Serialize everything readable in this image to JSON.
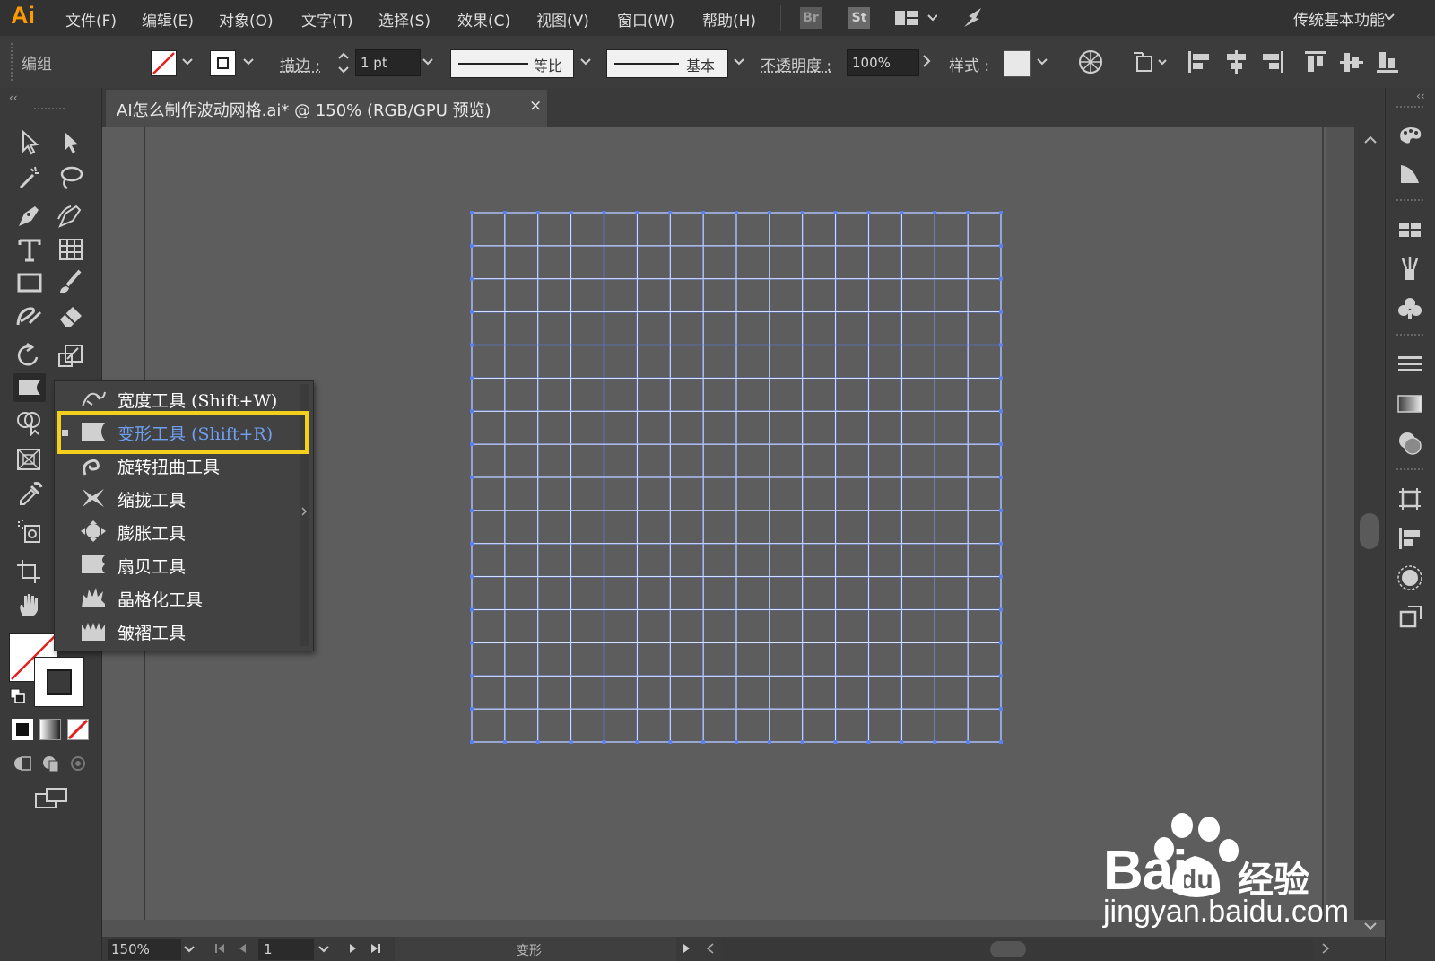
{
  "app": {
    "logo": "Ai"
  },
  "menubar": {
    "items": [
      "文件(F)",
      "编辑(E)",
      "对象(O)",
      "文字(T)",
      "选择(S)",
      "效果(C)",
      "视图(V)",
      "窗口(W)",
      "帮助(H)"
    ],
    "bridge_label": "Br",
    "stock_label": "St",
    "workspace": "传统基本功能"
  },
  "controlbar": {
    "selection_label": "编组",
    "stroke_label": "描边 :",
    "stroke_weight": "1 pt",
    "profile_label": "等比",
    "brush_label": "基本",
    "opacity_label": "不透明度 :",
    "opacity_value": "100%",
    "style_label": "样式 :"
  },
  "document": {
    "tab_title": "AI怎么制作波动网格.ai* @ 150% (RGB/GPU 预览)",
    "close_glyph": "×"
  },
  "grid": {
    "columns": 16,
    "rows": 16,
    "line_color": "#5a7ff0",
    "center_line_color": "#ffffff"
  },
  "flyout": {
    "items": [
      {
        "label": "宽度工具",
        "shortcut": "(Shift+W)",
        "icon": "width-tool-icon",
        "selected": false
      },
      {
        "label": "变形工具",
        "shortcut": "(Shift+R)",
        "icon": "warp-tool-icon",
        "selected": true
      },
      {
        "label": "旋转扭曲工具",
        "shortcut": "",
        "icon": "twirl-tool-icon",
        "selected": false
      },
      {
        "label": "缩拢工具",
        "shortcut": "",
        "icon": "pucker-tool-icon",
        "selected": false
      },
      {
        "label": "膨胀工具",
        "shortcut": "",
        "icon": "bloat-tool-icon",
        "selected": false
      },
      {
        "label": "扇贝工具",
        "shortcut": "",
        "icon": "scallop-tool-icon",
        "selected": false
      },
      {
        "label": "晶格化工具",
        "shortcut": "",
        "icon": "crystallize-tool-icon",
        "selected": false
      },
      {
        "label": "皱褶工具",
        "shortcut": "",
        "icon": "wrinkle-tool-icon",
        "selected": false
      }
    ],
    "highlight_color": "#f4cf1b"
  },
  "statusbar": {
    "zoom": "150%",
    "artboard": "1",
    "tool": "变形"
  },
  "watermark": {
    "brand": "Bai",
    "sub": "经验",
    "url": "jingyan.baidu.com"
  }
}
